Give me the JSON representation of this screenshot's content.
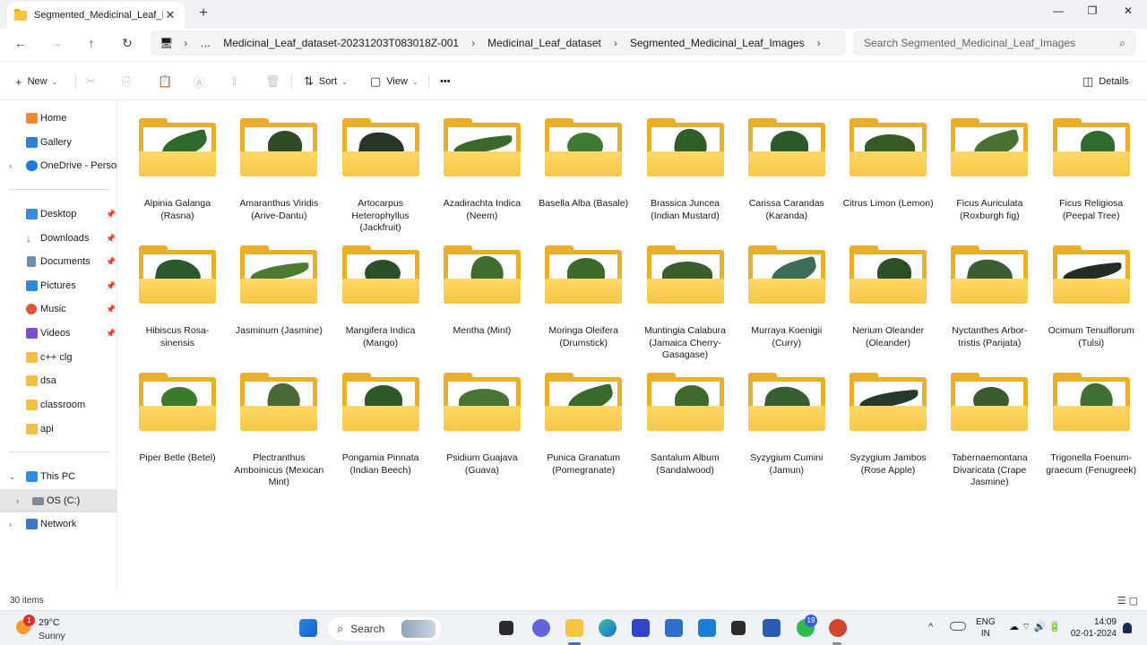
{
  "window": {
    "tab_title": "Segmented_Medicinal_Leaf_Im",
    "tab_close": "✕",
    "new_tab": "+",
    "minimize": "—",
    "maximize": "❐",
    "close": "✕"
  },
  "nav": {
    "back": "←",
    "forward": "→",
    "up": "↑",
    "refresh": "↻",
    "pc_icon": "🖥",
    "more_segments": "…",
    "breadcrumb": [
      "Medicinal_Leaf_dataset-20231203T083018Z-001",
      "Medicinal_Leaf_dataset",
      "Segmented_Medicinal_Leaf_Images"
    ],
    "sep": "›",
    "search_placeholder": "Search Segmented_Medicinal_Leaf_Images",
    "search_icon": "⌕"
  },
  "commands": {
    "new": "New",
    "sort": "Sort",
    "view": "View",
    "more": "•••",
    "details": "Details",
    "icons": {
      "new": "+",
      "cut": "✂",
      "copy": "⎘",
      "paste": "📋",
      "rename": "Ⓐ",
      "share": "⇪",
      "delete": "🗑",
      "sort": "⇅",
      "view": "▢",
      "details": "◫",
      "dropdown": "⌄"
    }
  },
  "sidebar": {
    "items": [
      {
        "label": "Home",
        "color": "#f08a32"
      },
      {
        "label": "Gallery",
        "color": "#2f7fd8"
      },
      {
        "label": "OneDrive - Persona",
        "color": "#1e7ad6"
      },
      {
        "label": "Desktop",
        "color": "#3a8be0"
      },
      {
        "label": "Downloads",
        "color": "#2a7c5c"
      },
      {
        "label": "Documents",
        "color": "#6f8fb0"
      },
      {
        "label": "Pictures",
        "color": "#2c8ad8"
      },
      {
        "label": "Music",
        "color": "#e0553b"
      },
      {
        "label": "Videos",
        "color": "#7a4fd1"
      },
      {
        "label": "c++ clg",
        "color": "#f2c143"
      },
      {
        "label": "dsa",
        "color": "#f2c143"
      },
      {
        "label": "classroom",
        "color": "#f2c143"
      },
      {
        "label": "api",
        "color": "#f2c143"
      },
      {
        "label": "This PC",
        "color": "#2d8de0"
      },
      {
        "label": "OS (C:)",
        "color": "#7f8a96"
      },
      {
        "label": "Network",
        "color": "#3a77c9"
      }
    ],
    "chevron_right": "›",
    "chevron_down": "⌄",
    "pin": "📌"
  },
  "folders": [
    {
      "name": "Alpinia Galanga (Rasna)",
      "leaf": "#2e6b2a"
    },
    {
      "name": "Amaranthus Viridis (Arive-Dantu)",
      "leaf": "#2f4a25"
    },
    {
      "name": "Artocarpus Heterophyllus (Jackfruit)",
      "leaf": "#26372a"
    },
    {
      "name": "Azadirachta Indica (Neem)",
      "leaf": "#3b6a2c"
    },
    {
      "name": "Basella Alba (Basale)",
      "leaf": "#3f7a33"
    },
    {
      "name": "Brassica Juncea (Indian Mustard)",
      "leaf": "#2f5e27"
    },
    {
      "name": "Carissa Carandas (Karanda)",
      "leaf": "#2d5a2a"
    },
    {
      "name": "Citrus Limon (Lemon)",
      "leaf": "#3a5a25"
    },
    {
      "name": "Ficus Auriculata (Roxburgh fig)",
      "leaf": "#4a7034"
    },
    {
      "name": "Ficus Religiosa (Peepal Tree)",
      "leaf": "#2f6a31"
    },
    {
      "name": "Hibiscus Rosa-sinensis",
      "leaf": "#2b5a2e"
    },
    {
      "name": "Jasminum (Jasmine)",
      "leaf": "#4b7a30"
    },
    {
      "name": "Mangifera Indica (Mango)",
      "leaf": "#2c5029"
    },
    {
      "name": "Mentha (Mint)",
      "leaf": "#3f6d2d"
    },
    {
      "name": "Moringa Oleifera (Drumstick)",
      "leaf": "#3c6a2a"
    },
    {
      "name": "Muntingia Calabura (Jamaica Cherry-Gasagase)",
      "leaf": "#3a5f2c"
    },
    {
      "name": "Murraya Koenigii (Curry)",
      "leaf": "#3e6e5a"
    },
    {
      "name": "Nerium Oleander (Oleander)",
      "leaf": "#2c4f26"
    },
    {
      "name": "Nyctanthes Arbor-tristis (Parijata)",
      "leaf": "#3d5e34"
    },
    {
      "name": "Ocimum Tenuiflorum (Tulsi)",
      "leaf": "#232c25"
    },
    {
      "name": "Piper Betle (Betel)",
      "leaf": "#3a7a2a"
    },
    {
      "name": "Plectranthus Amboinicus (Mexican Mint)",
      "leaf": "#4a6a35"
    },
    {
      "name": "Pongamia Pinnata (Indian Beech)",
      "leaf": "#2f5a27"
    },
    {
      "name": "Psidium Guajava (Guava)",
      "leaf": "#4a7532"
    },
    {
      "name": "Punica Granatum (Pomegranate)",
      "leaf": "#3a6a2c"
    },
    {
      "name": "Santalum Album (Sandalwood)",
      "leaf": "#3f6a2e"
    },
    {
      "name": "Syzygium Cumini (Jamun)",
      "leaf": "#375f2f"
    },
    {
      "name": "Syzygium Jambos (Rose Apple)",
      "leaf": "#263a2c"
    },
    {
      "name": "Tabernaemontana Divaricata (Crape Jasmine)",
      "leaf": "#3c5a2f"
    },
    {
      "name": "Trigonella Foenum-graecum (Fenugreek)",
      "leaf": "#3f6f33"
    }
  ],
  "status": {
    "count": "30 items",
    "view_icons": "☰ ▢"
  },
  "taskbar": {
    "weather_badge": "1",
    "temperature": "29°C",
    "condition": "Sunny",
    "search_label": "Search",
    "search_icon": "⌕",
    "whatsapp_badge": "19",
    "lang": "ENG",
    "region": "IN",
    "time": "14:09",
    "date": "02-01-2024",
    "tray_chevron": "^",
    "tray_icons": "☁  ⌔ 🔊 🔋"
  }
}
